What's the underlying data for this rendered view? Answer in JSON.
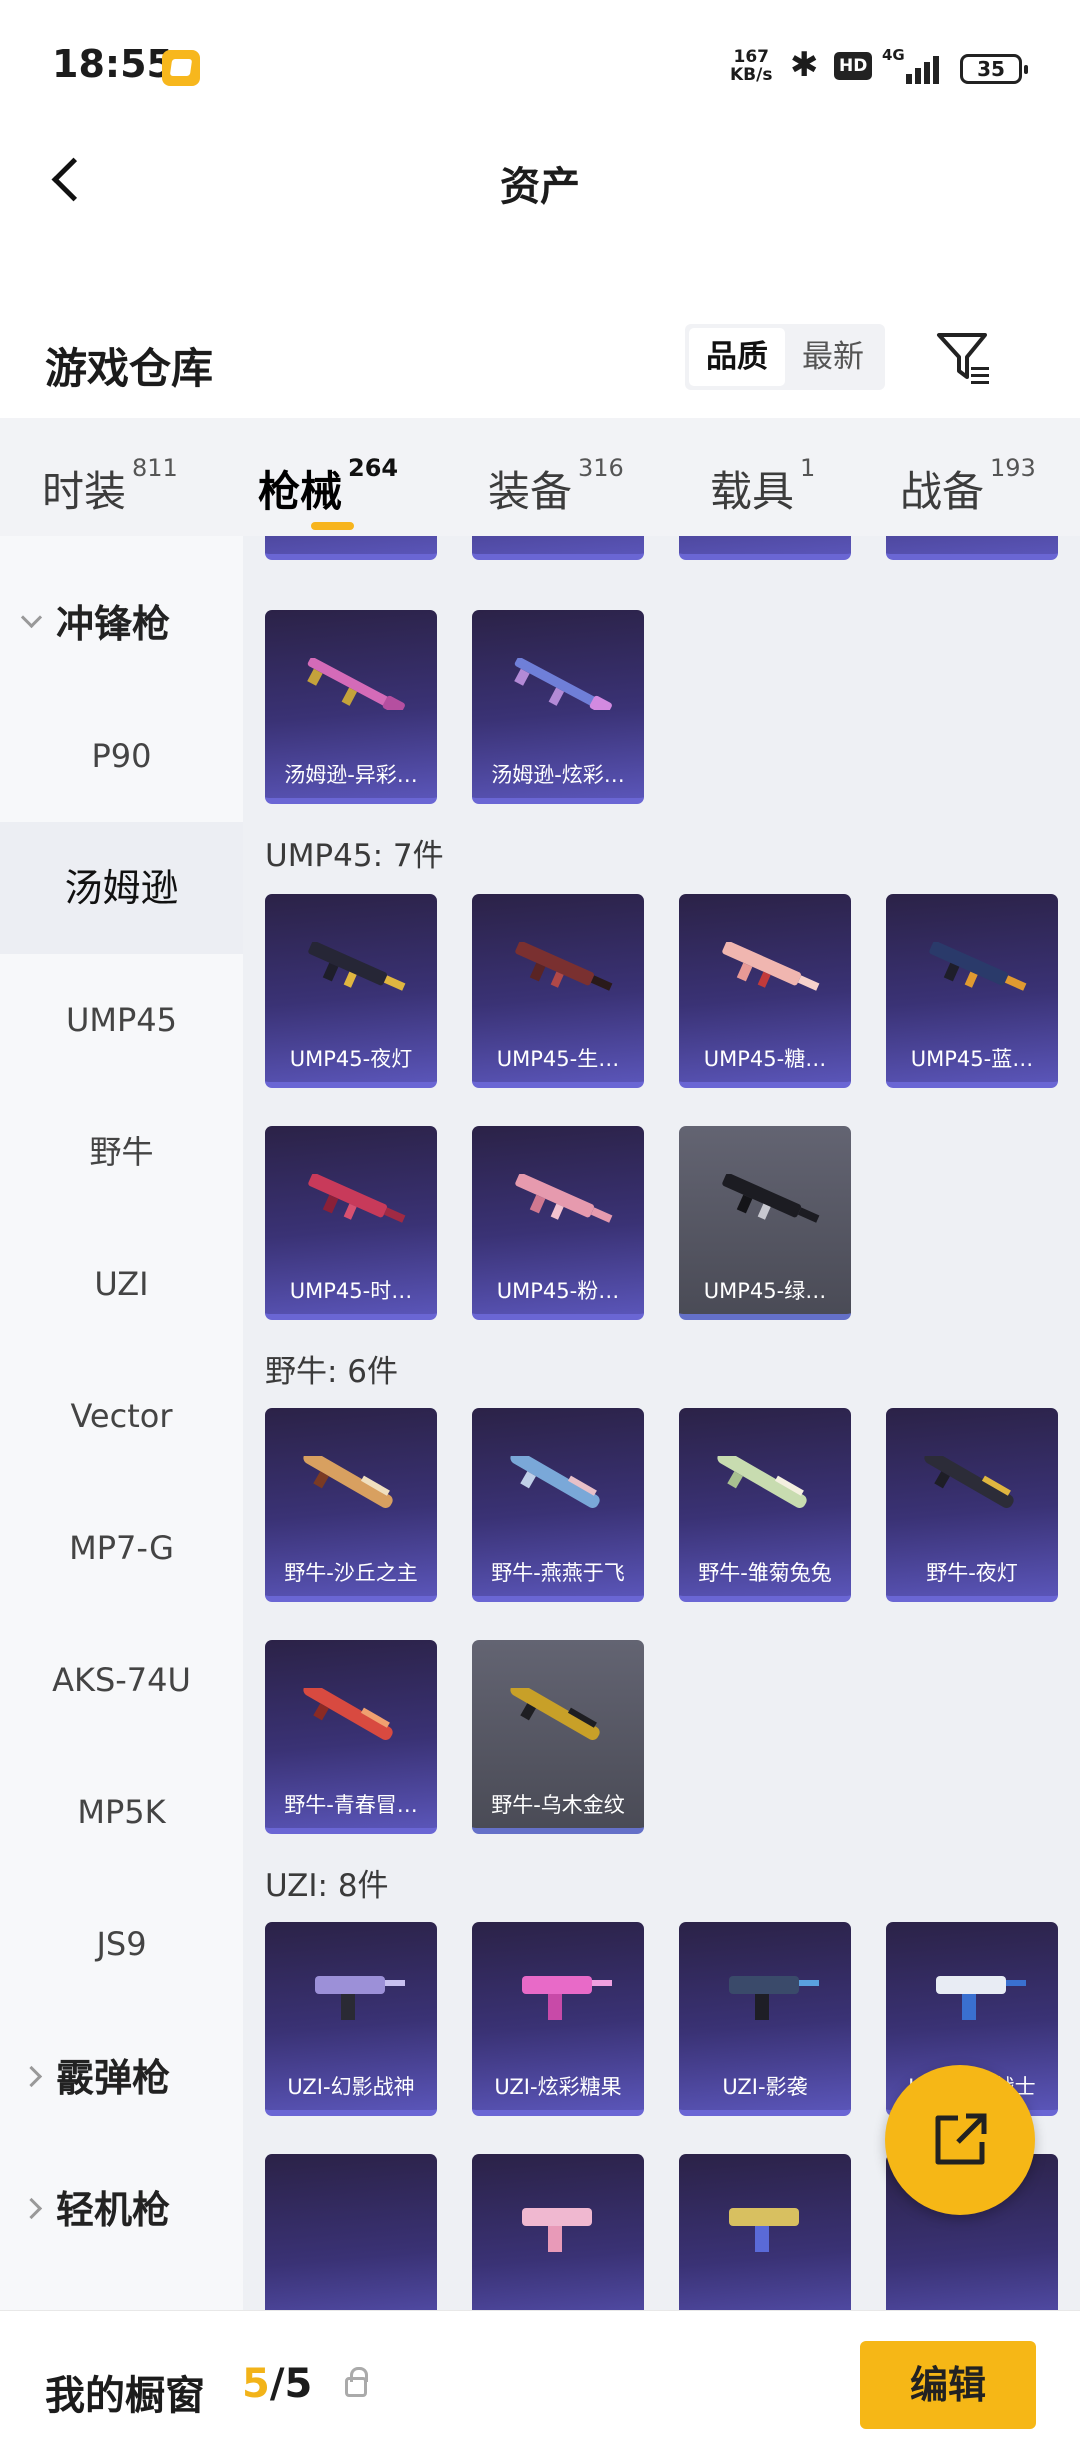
{
  "status": {
    "time": "18:55",
    "speed_value": "167",
    "speed_unit": "KB/s",
    "bt_icon": "bluetooth-icon",
    "hd": "HD",
    "net": "4G",
    "battery": "35"
  },
  "header": {
    "title": "资产"
  },
  "warehouse": {
    "title": "游戏仓库",
    "sort_quality": "品质",
    "sort_latest": "最新"
  },
  "tabs": [
    {
      "label": "时装",
      "count": "811"
    },
    {
      "label": "枪械",
      "count": "264"
    },
    {
      "label": "装备",
      "count": "316"
    },
    {
      "label": "载具",
      "count": "1"
    },
    {
      "label": "战备",
      "count": "193"
    }
  ],
  "sidebar": {
    "items": [
      "冲锋枪",
      "P90",
      "汤姆逊",
      "UMP45",
      "野牛",
      "UZI",
      "Vector",
      "MP7-G",
      "AKS-74U",
      "MP5K",
      "JS9",
      "霰弹枪",
      "轻机枪"
    ]
  },
  "sections": [
    {
      "header": "",
      "cards": [
        "汤姆逊-异彩…",
        "汤姆逊-炫彩…"
      ]
    },
    {
      "header": "UMP45: 7件",
      "cards": [
        "UMP45-夜灯",
        "UMP45-生…",
        "UMP45-糖…",
        "UMP45-蓝…",
        "UMP45-时…",
        "UMP45-粉…",
        "UMP45-绿…"
      ]
    },
    {
      "header": "野牛: 6件",
      "cards": [
        "野牛-沙丘之主",
        "野牛-燕燕于飞",
        "野牛-雏菊兔兔",
        "野牛-夜灯",
        "野牛-青春冒…",
        "野牛-乌木金纹"
      ]
    },
    {
      "header": "UZI: 8件",
      "cards": [
        "UZI-幻影战神",
        "UZI-炫彩糖果",
        "UZI-影袭",
        "UZI-银河战士"
      ]
    }
  ],
  "showcase": {
    "title": "我的橱窗",
    "current": "5",
    "total": "/5",
    "edit_label": "编辑"
  },
  "colors": {
    "accent": "#F6B716",
    "card_purple": "#3A3275"
  }
}
